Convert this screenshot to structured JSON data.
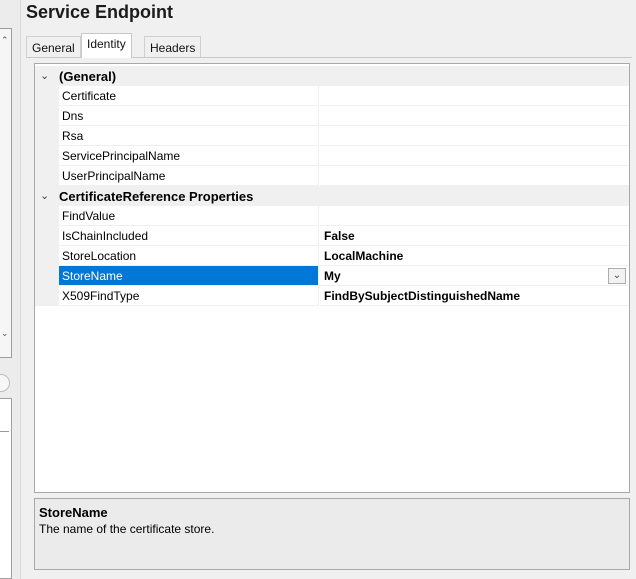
{
  "title": "Service Endpoint",
  "tabs": [
    {
      "label": "General",
      "active": false
    },
    {
      "label": "Identity",
      "active": true
    },
    {
      "label": "Headers",
      "active": false
    }
  ],
  "categories": {
    "general": {
      "label": "(General)",
      "properties": [
        {
          "name": "Certificate",
          "value": ""
        },
        {
          "name": "Dns",
          "value": ""
        },
        {
          "name": "Rsa",
          "value": ""
        },
        {
          "name": "ServicePrincipalName",
          "value": ""
        },
        {
          "name": "UserPrincipalName",
          "value": ""
        }
      ]
    },
    "certref": {
      "label": "CertificateReference Properties",
      "properties": [
        {
          "name": "FindValue",
          "value": ""
        },
        {
          "name": "IsChainIncluded",
          "value": "False"
        },
        {
          "name": "StoreLocation",
          "value": "LocalMachine"
        },
        {
          "name": "StoreName",
          "value": "My"
        },
        {
          "name": "X509FindType",
          "value": "FindBySubjectDistinguishedName"
        }
      ]
    }
  },
  "selected_property": "StoreName",
  "description": {
    "title": "StoreName",
    "text": "The name of the certificate store."
  },
  "colors": {
    "selection": "#0078d7",
    "category_bg": "#f0f0f0"
  }
}
